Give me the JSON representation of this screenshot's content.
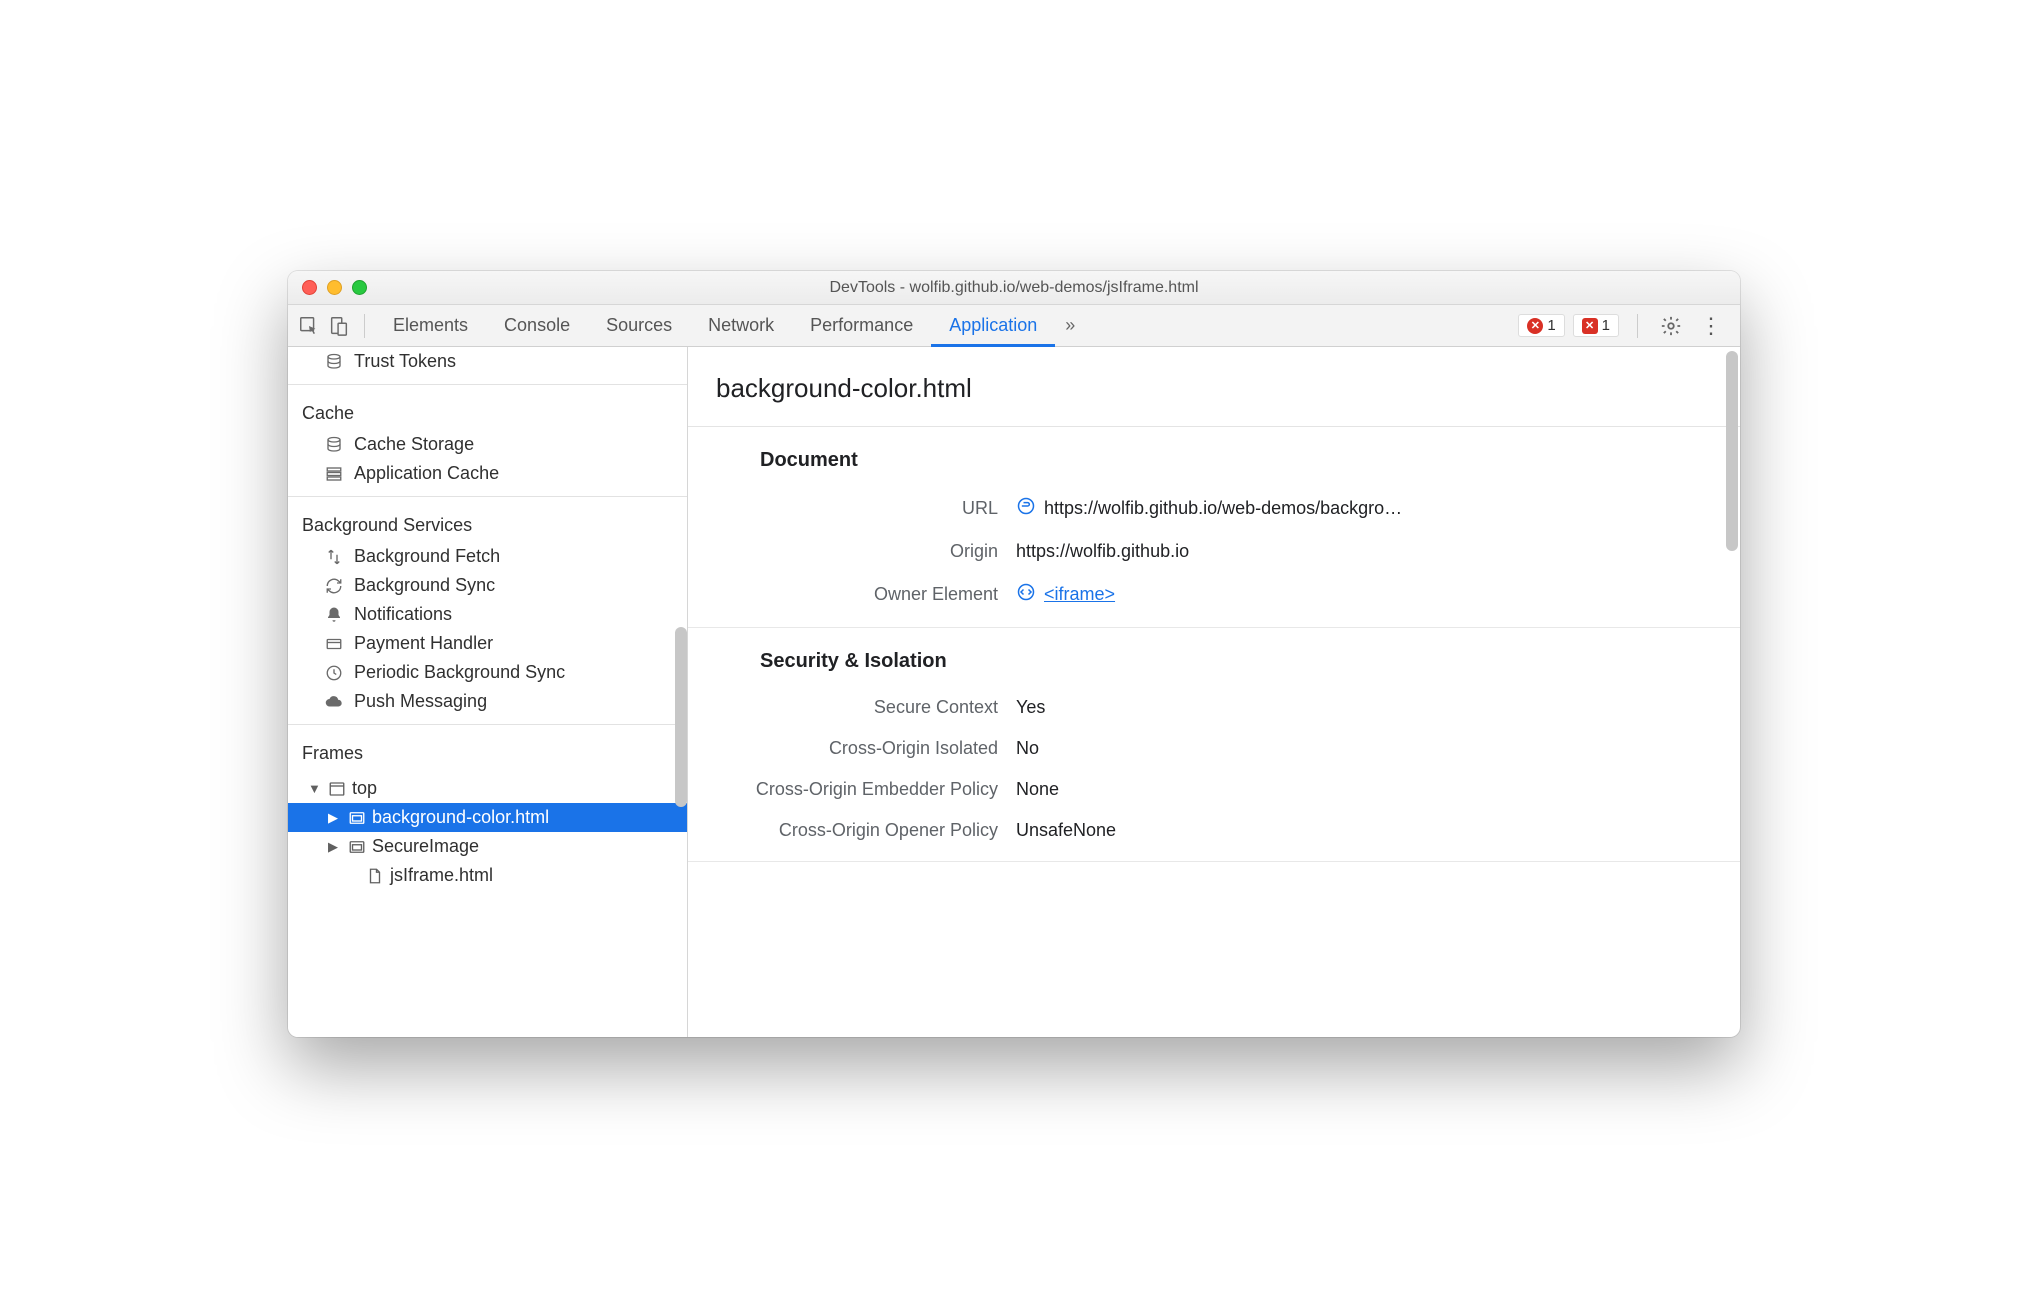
{
  "window": {
    "title": "DevTools - wolfib.github.io/web-demos/jsIframe.html"
  },
  "toolbar": {
    "tabs": {
      "elements": "Elements",
      "console": "Console",
      "sources": "Sources",
      "network": "Network",
      "performance": "Performance",
      "application": "Application"
    },
    "error_count": "1",
    "issue_count": "1"
  },
  "sidebar": {
    "trust_tokens": "Trust Tokens",
    "cache": {
      "title": "Cache",
      "cache_storage": "Cache Storage",
      "application_cache": "Application Cache"
    },
    "bg": {
      "title": "Background Services",
      "fetch": "Background Fetch",
      "sync": "Background Sync",
      "notifications": "Notifications",
      "payment": "Payment Handler",
      "periodic": "Periodic Background Sync",
      "push": "Push Messaging"
    },
    "frames": {
      "title": "Frames",
      "top": "top",
      "bgc": "background-color.html",
      "secure": "SecureImage",
      "jsiframe": "jsIframe.html"
    }
  },
  "main": {
    "title": "background-color.html",
    "document": {
      "section": "Document",
      "url_label": "URL",
      "url_value": "https://wolfib.github.io/web-demos/backgro…",
      "origin_label": "Origin",
      "origin_value": "https://wolfib.github.io",
      "owner_label": "Owner Element",
      "owner_value": "<iframe>"
    },
    "security": {
      "section": "Security & Isolation",
      "secure_ctx_label": "Secure Context",
      "secure_ctx_value": "Yes",
      "coi_label": "Cross-Origin Isolated",
      "coi_value": "No",
      "coep_label": "Cross-Origin Embedder Policy",
      "coep_value": "None",
      "coop_label": "Cross-Origin Opener Policy",
      "coop_value": "UnsafeNone"
    }
  }
}
